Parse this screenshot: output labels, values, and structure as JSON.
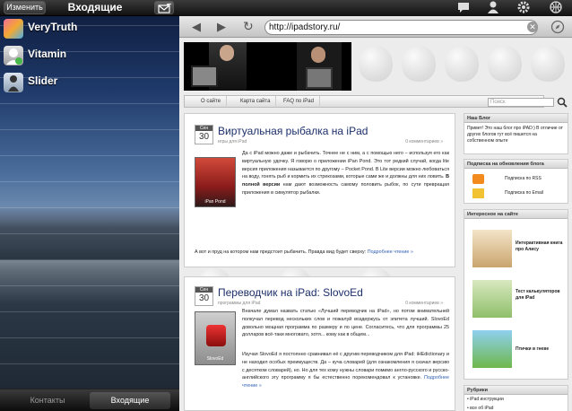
{
  "mail": {
    "edit_label": "Изменить",
    "title": "Входящие",
    "contacts": [
      {
        "name": "VeryTruth"
      },
      {
        "name": "Vitamin"
      },
      {
        "name": "Slider"
      }
    ],
    "tabs": [
      "Контакты",
      "Входящие"
    ]
  },
  "browser": {
    "url": "http://ipadstory.ru/",
    "menu": [
      "О сайте",
      "Карта сайта",
      "FAQ по iPad"
    ],
    "search_placeholder": "Поиск",
    "posts": [
      {
        "month": "Сен",
        "day": "30",
        "title": "Виртуальная рыбалка на iPad",
        "category": "игры для iPad",
        "comments": "0 комментариев »",
        "thumb_label": "iPan Pond",
        "body": "Да с iPad можно даже и рыбачить. Точнее не с ним, а с помощью него – используя его как виртуальную удочку. Я говорю о приложении iPan Pond. Это тот редкий случай, когда lite версия приложения называется по другому – Pocket Pond. В Lite версии можно любоваться на воду, гонять рыб и кормить их стрекозами, которые сами же и должны для них ловить.",
        "bold": "В полной версии",
        "body_tail": "нам дают возможность самому половить рыбок, по сути превращая приложения в симулятор рыбалки.",
        "more": "А вот и пруд на котором нам предстоит рыбачить. Правда вид будет сверху:",
        "more_link": "Подробнее чтение »"
      },
      {
        "month": "Сен",
        "day": "30",
        "title": "Переводчик на iPad: SlovoEd",
        "category": "программы для iPad",
        "comments": "0 комментариев »",
        "thumb_label": "SlovoEd",
        "body": "Вначале думал назвать статью «Лучший переводчик на iPad», но потом внимательней полкучал перевод нескольких слов и пожалуй воздержусь от эпитета лучший. SlovoEd довольно мощная программа по размеру и по цене. Согласитесь, что для программы 25 долларов всё-таки многовато, хотя... кому как в общем...",
        "para2": "Изучая SlovoEd я постоянно сравнивал её с другим переводчиком для iPad: iHEdictionary и не находил особых преимуществ. Да – куча словарей (для ознакомления я скачал версию с десятком словарей), но. Но для тех кому нужны словари помимо англо-русского и русско-английского эту программу я бы естественно порекомендовал к установке.",
        "more_link": "Подробнее чтение »"
      }
    ],
    "sidebar": {
      "blog_head": "Наш Блог",
      "blog_text": "Привет! Это наш блог про iPAD:) В отличие от других блогов тут всё пишется на собственном опыте",
      "subscribe_head": "Подписка на обновления блога",
      "rss": "Подписка по RSS",
      "email": "Подписка по Email",
      "interesting_head": "Интересное на сайте",
      "apps": [
        "Интерактивная книга про Алису",
        "Тест калькуляторов для iPad",
        "Птички в гневе"
      ],
      "rubrics_head": "Рубрики",
      "rubrics": [
        "iPad инструкции",
        "все об iPad"
      ]
    }
  }
}
